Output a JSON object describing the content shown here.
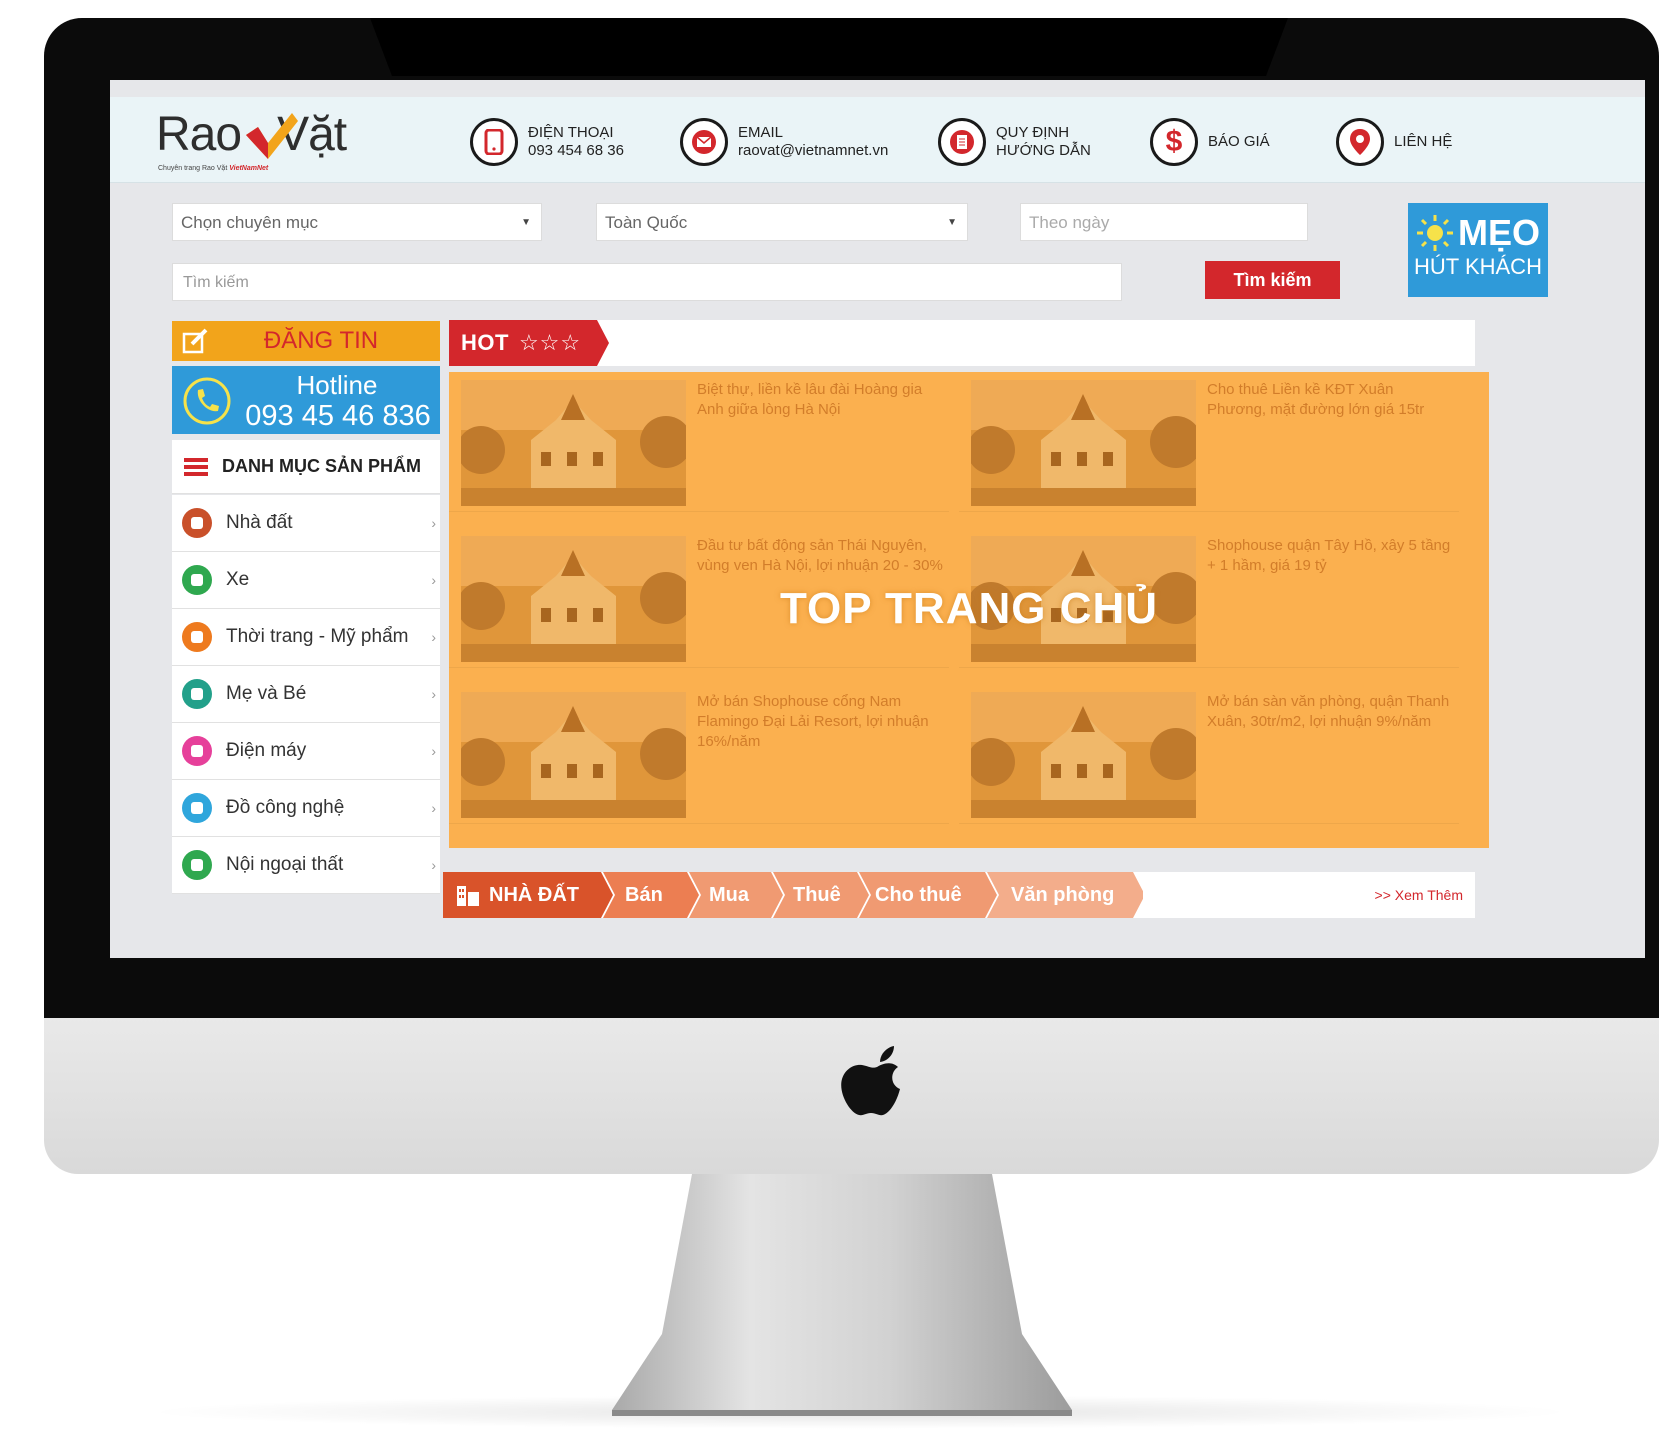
{
  "logo": {
    "part1": "Rao",
    "part2": "Vặt",
    "tagline_prefix": "Chuyên trang Rao Vặt",
    "tagline_brand": "VietNamNet"
  },
  "header": {
    "items": [
      {
        "line1": "ĐIỆN THOẠI",
        "line2": "093 454 68 36",
        "icon": "phone-icon"
      },
      {
        "line1": "EMAIL",
        "line2": "raovat@vietnamnet.vn",
        "icon": "mail-icon"
      },
      {
        "line1": "QUY ĐỊNH",
        "line2": "HƯỚNG DẪN",
        "icon": "document-icon"
      },
      {
        "line1": "BÁO GIÁ",
        "line2": "",
        "icon": "dollar-icon"
      },
      {
        "line1": "LIÊN HỆ",
        "line2": "",
        "icon": "location-pin-icon"
      }
    ]
  },
  "search": {
    "category_select": "Chọn chuyên mục",
    "region_select": "Toàn Quốc",
    "date_placeholder": "Theo ngày",
    "keyword_placeholder": "Tìm kiếm",
    "button": "Tìm kiếm"
  },
  "meo": {
    "title": "MẸO",
    "subtitle": "HÚT KHÁCH"
  },
  "sidebar": {
    "post_button": "ĐĂNG TIN",
    "hotline_title": "Hotline",
    "hotline_number": "093 45 46 836",
    "menu_title": "DANH MỤC SẢN PHẨM",
    "categories": [
      {
        "label": "Nhà đất",
        "color": "#c9502a"
      },
      {
        "label": "Xe",
        "color": "#2fa84f"
      },
      {
        "label": "Thời trang - Mỹ phẩm",
        "color": "#ee7a1e"
      },
      {
        "label": "Mẹ và Bé",
        "color": "#22a08a"
      },
      {
        "label": "Điện máy",
        "color": "#e6409a"
      },
      {
        "label": "Đồ công nghệ",
        "color": "#2fa6dc"
      },
      {
        "label": "Nội ngoại thất",
        "color": "#2fa84f"
      }
    ]
  },
  "hot": {
    "label": "HOT",
    "stars": "☆☆☆",
    "overlay": "TOP TRANG CHỦ",
    "listings": [
      "Biệt thự, liền kề lâu đài Hoàng gia Anh giữa lòng Hà Nội",
      "Cho thuê Liền kề KĐT Xuân Phương, mặt đường lớn giá 15tr",
      "Đầu tư bất động sản Thái Nguyên, vùng ven Hà Nội, lợi nhuận 20 - 30%",
      "Shophouse quận Tây Hồ, xây 5 tầng + 1 hầm, giá 19 tỷ",
      "Mở bán Shophouse cổng Nam Flamingo Đại Lải Resort, lợi nhuận 16%/năm",
      "Mở bán sàn văn phòng, quận Thanh Xuân, 30tr/m2, lợi nhuận 9%/năm"
    ]
  },
  "section_nav": {
    "title": "NHÀ ĐẤT",
    "tabs": [
      "Bán",
      "Mua",
      "Thuê",
      "Cho thuê",
      "Văn phòng"
    ],
    "more": ">> Xem Thêm"
  },
  "colors": {
    "brand_red": "#d3272c",
    "accent_orange": "#f2a41b",
    "hot_panel": "#fbb04f",
    "hotline_blue": "#2f9ad9"
  }
}
